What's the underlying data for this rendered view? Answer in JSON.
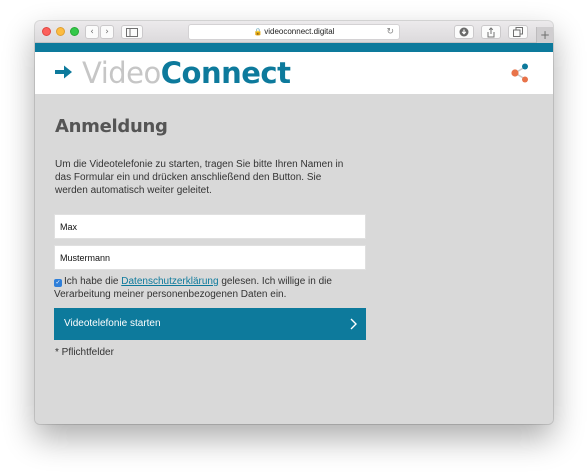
{
  "browser": {
    "url": "videoconnect.digital",
    "nav_back": "‹",
    "nav_forward": "›",
    "sidebar_icon": "sidebar-icon",
    "download_icon": "download-icon",
    "share_icon": "share-icon",
    "tabs_icon": "tabs-icon",
    "new_tab": "+"
  },
  "header": {
    "logo_part1": "Video",
    "logo_part2": "Connect",
    "colors": {
      "teal": "#0d7a9c",
      "logo_grey": "#c6c6c6",
      "orange": "#e8734a"
    }
  },
  "main": {
    "title": "Anmeldung",
    "intro": "Um die Videotelefonie zu starten, tragen Sie bitte Ihren Namen in das Formular ein und drücken anschließend den Button. Sie werden automatisch weiter geleitet.",
    "first_name_value": "Max",
    "last_name_value": "Mustermann",
    "consent_before": "Ich habe die ",
    "consent_link": "Datenschutzerklärung",
    "consent_after": " gelesen. Ich willige in die Verarbeitung meiner personenbezogenen Daten ein.",
    "consent_checked": true,
    "button_label": "Videotelefonie starten",
    "required_note": "* Pflichtfelder"
  }
}
